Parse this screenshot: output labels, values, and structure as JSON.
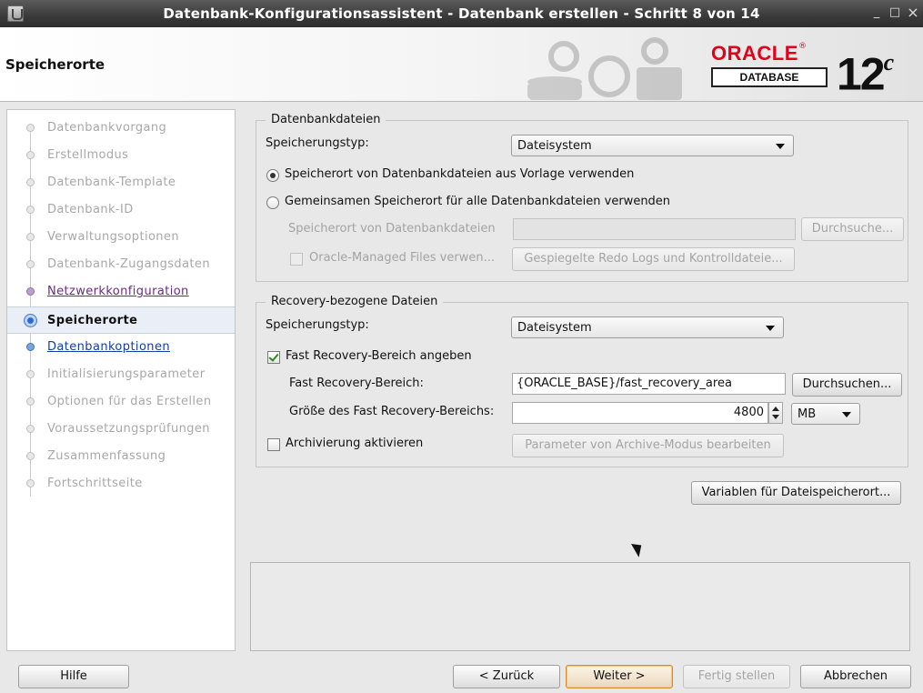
{
  "window": {
    "title": "Datenbank-Konfigurationsassistent - Datenbank erstellen - Schritt 8 von 14",
    "controls": {
      "minimize": "_",
      "maximize": "□",
      "close": "×"
    }
  },
  "header": {
    "page_title": "Speicherorte",
    "logo_word": "ORACLE",
    "logo_reg": "®",
    "logo_sub": "DATABASE",
    "version": "12",
    "version_suffix": "c"
  },
  "nav": {
    "steps": [
      {
        "label": "Datenbankvorgang",
        "state": "disabled"
      },
      {
        "label": "Erstellmodus",
        "state": "disabled"
      },
      {
        "label": "Datenbank-Template",
        "state": "disabled"
      },
      {
        "label": "Datenbank-ID",
        "state": "disabled"
      },
      {
        "label": "Verwaltungsoptionen",
        "state": "disabled"
      },
      {
        "label": "Datenbank-Zugangsdaten",
        "state": "disabled"
      },
      {
        "label": "Netzwerkkonfiguration",
        "state": "visited"
      },
      {
        "label": "Speicherorte",
        "state": "active"
      },
      {
        "label": "Datenbankoptionen",
        "state": "link"
      },
      {
        "label": "Initialisierungsparameter",
        "state": "disabled"
      },
      {
        "label": "Optionen für das Erstellen",
        "state": "disabled"
      },
      {
        "label": "Voraussetzungsprüfungen",
        "state": "disabled"
      },
      {
        "label": "Zusammenfassung",
        "state": "disabled"
      },
      {
        "label": "Fortschrittseite",
        "state": "disabled"
      }
    ]
  },
  "db_files": {
    "legend": "Datenbankdateien",
    "storage_type_label": "Speicherungstyp:",
    "storage_type_value": "Dateisystem",
    "radio_template_label": "Speicherort von Datenbankdateien aus Vorlage verwenden",
    "radio_common_label": "Gemeinsamen Speicherort für alle Datenbankdateien verwenden",
    "location_label": "Speicherort von Datenbankdateien",
    "location_value": "",
    "browse_label": "Durchsuche...",
    "omf_label": "Oracle-Managed Files verwen...",
    "mirrored_button": "Gespiegelte Redo Logs und Kontrolldateie..."
  },
  "recovery": {
    "legend": "Recovery-bezogene Dateien",
    "storage_type_label": "Speicherungstyp:",
    "storage_type_value": "Dateisystem",
    "fra_checkbox_label": "Fast Recovery-Bereich angeben",
    "fra_label": "Fast Recovery-Bereich:",
    "fra_value": "{ORACLE_BASE}/fast_recovery_area",
    "browse_label": "Durchsuchen...",
    "size_label": "Größe des Fast Recovery-Bereichs:",
    "size_value": "4800",
    "size_unit": "MB",
    "archive_label": "Archivierung aktivieren",
    "archive_params_button": "Parameter von Archive-Modus bearbeiten"
  },
  "variables_button": "Variablen für Dateispeicherort...",
  "footer": {
    "help": "Hilfe",
    "back": "< Zurück",
    "next": "Weiter >",
    "finish": "Fertig stellen",
    "cancel": "Abbrechen"
  }
}
